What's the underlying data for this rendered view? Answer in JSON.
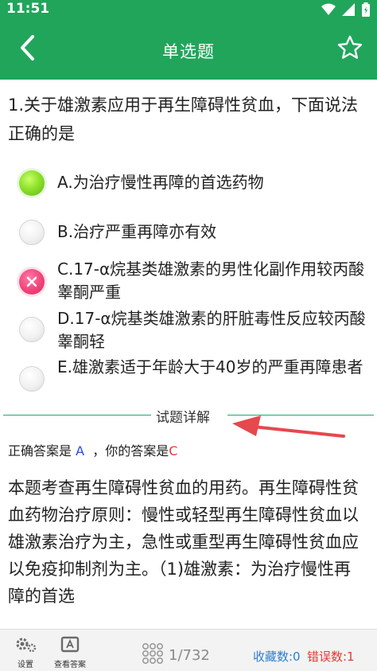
{
  "status_bar": {
    "time": "11:51",
    "icons": [
      "wifi-icon",
      "signal-icon",
      "battery-icon"
    ]
  },
  "app_bar": {
    "title": "单选题",
    "back_icon": "chevron-left-icon",
    "favorite_icon": "star-outline-icon"
  },
  "question": {
    "text": "1.关于雄激素应用于再生障碍性贫血，下面说法正确的是"
  },
  "options": [
    {
      "label": "A.为治疗慢性再障的首选药物",
      "state": "correct"
    },
    {
      "label": "B.治疗严重再障亦有效",
      "state": "none"
    },
    {
      "label": "C.17-α烷基类雄激素的男性化副作用较丙酸睾酮严重",
      "state": "wrong"
    },
    {
      "label": "D.17-α烷基类雄激素的肝脏毒性反应较丙酸睾酮轻",
      "state": "none"
    },
    {
      "label": "E.雄激素适于年龄大于40岁的严重再障患者",
      "state": "none"
    }
  ],
  "detail": {
    "heading": "试题详解"
  },
  "answer": {
    "prefix": "正确答案是",
    "correct": "A",
    "separator": "，你的答案是",
    "user": "C"
  },
  "explanation": "本题考查再生障碍性贫血的用药。再生障碍性贫血药物治疗原则：慢性或轻型再生障碍性贫血以雄激素治疗为主，急性或重型再生障碍性贫血应以免疫抑制剂为主。（1)雄激素：为治疗慢性再障的首选",
  "bottom_bar": {
    "settings_label": "设置",
    "view_answer_label": "查看答案",
    "progress": "1/732",
    "favorites": "收藏数:0",
    "errors": "错误数:1"
  },
  "colors": {
    "primary": "#21a55b",
    "correct_answer": "#1f4fd8",
    "user_answer": "#e53935",
    "favorites": "#2a7fd6"
  }
}
